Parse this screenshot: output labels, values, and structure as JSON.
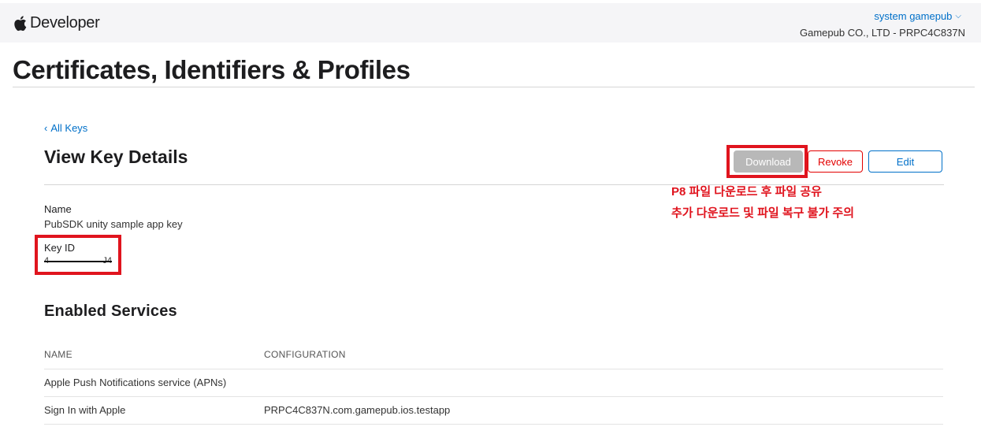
{
  "header": {
    "brand": "Developer",
    "account_name": "system gamepub",
    "team_name": "Gamepub CO., LTD - PRPC4C837N"
  },
  "page": {
    "title": "Certificates, Identifiers & Profiles",
    "back_link": "All Keys",
    "section_title": "View Key Details"
  },
  "actions": {
    "download": "Download",
    "revoke": "Revoke",
    "edit": "Edit"
  },
  "annotation": {
    "line1": "P8 파일 다운로드 후 파일 공유",
    "line2": "추가 다운로드 및 파일 복구 불가 주의",
    "color": "#e0141e"
  },
  "key": {
    "name_label": "Name",
    "name_value": "PubSDK unity sample app key",
    "id_label": "Key ID",
    "id_value_start": "4",
    "id_value_end": "J4"
  },
  "services": {
    "title": "Enabled Services",
    "columns": [
      "NAME",
      "CONFIGURATION"
    ],
    "rows": [
      {
        "name": "Apple Push Notifications service (APNs)",
        "configuration": ""
      },
      {
        "name": "Sign In with Apple",
        "configuration": "PRPC4C837N.com.gamepub.ios.testapp"
      }
    ]
  },
  "colors": {
    "link": "#0070c9",
    "revoke": "#e30000",
    "download_disabled": "#b8b8b8"
  }
}
